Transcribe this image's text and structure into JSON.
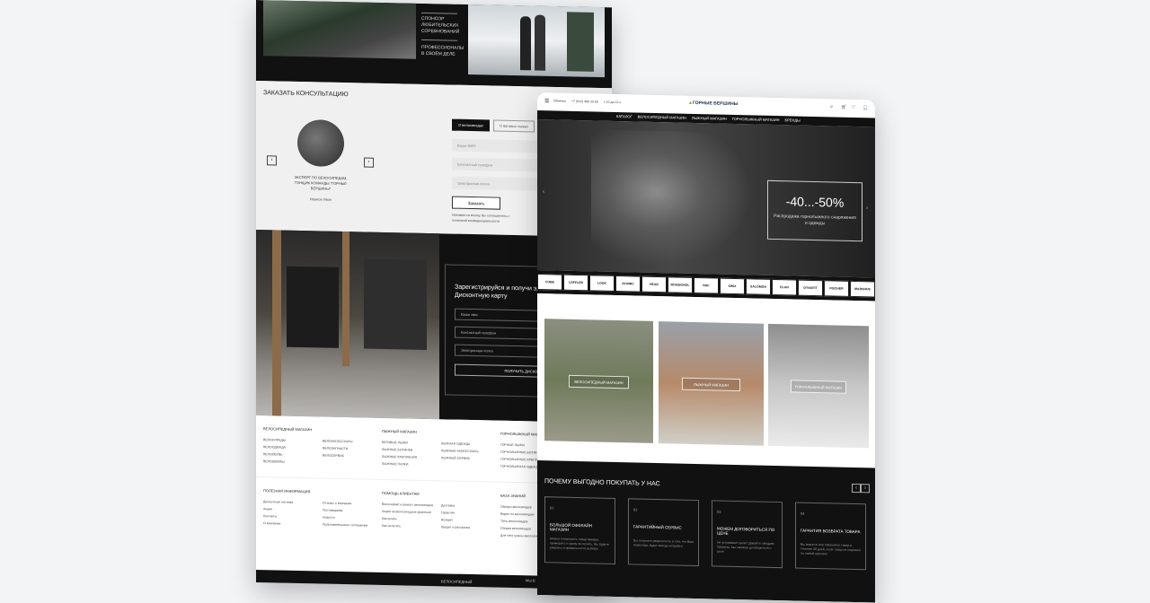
{
  "back": {
    "sponsor_1": "СПОНСОР ЛЮБИТЕЛЬСКИХ СОРЕВНОВАНИЙ",
    "sponsor_2": "ПРОФЕССИОНАЛЫ В СВОЁМ ДЕЛЕ",
    "consult_title": "ЗАКАЗАТЬ КОНСУЛЬТАЦИЮ",
    "expert_caption": "ЭКСПЕРТ ПО ВЕЛОСИПЕДАМ, ГОНЩИК КОМАНДЫ \"ГОРНЫЕ ВЕРШИНЫ\"",
    "expert_name": "Иванов Иван",
    "tab_active": "О велосипедах",
    "tab_inactive": "О беговых лыжах",
    "name_ph": "Ваше ФИО",
    "phone_ph": "Контактный телефон",
    "email_ph": "Электронная почта",
    "order_btn": "Заказать",
    "consent": "Нажимая на кнопку, Вы соглашаетесь с политикой конфиденциальности",
    "register_title": "Зарегистрируйся и получи электронную Дисконтную карту",
    "reg_name_ph": "Ваше имя",
    "reg_phone_ph": "Контактный телефон",
    "reg_email_ph": "Электронная почта",
    "card_btn": "ПОЛУЧИТЬ ДИСКОНТНУЮ КАРТУ",
    "footer_cols": [
      {
        "title": "ВЕЛОСИПЕДНЫЙ МАГАЗИН",
        "items": [
          "ВЕЛОСИПЕДЫ",
          "ВЕЛООДЕЖДА",
          "ВЕЛООБУВЬ",
          "ВЕЛОШЛЕМЫ"
        ]
      },
      {
        "title": "",
        "items": [
          "ВЕЛОАКСЕССУАРЫ",
          "ВЕЛОЗАПЧАСТИ",
          "ВЕЛОСЕРВИС"
        ]
      },
      {
        "title": "ЛЫЖНЫЙ МАГАЗИН",
        "items": [
          "БЕГОВЫЕ ЛЫЖИ",
          "ЛЫЖНЫЕ БОТИНКИ",
          "ЛЫЖНЫЕ КРЕПЛЕНИЯ",
          "ЛЫЖНЫЕ ПАЛКИ"
        ]
      },
      {
        "title": "",
        "items": [
          "ЛЫЖНАЯ ОДЕЖДА",
          "ЛЫЖНЫЕ АКСЕССУАРЫ",
          "ЛЫЖНЫЙ СЕРВИС"
        ]
      },
      {
        "title": "ГОРНОЛЫЖНЫЙ МАГАЗИН",
        "items": [
          "ГОРНЫЕ ЛЫЖИ",
          "ГОРНОЛЫЖНЫЕ БОТИНКИ",
          "ГОРНОЛЫЖНЫЕ КРЕПЛЕНИЯ",
          "ГОРНОЛЫЖНАЯ ОДЕЖДА"
        ]
      }
    ],
    "info_cols": [
      {
        "title": "ПОЛЕЗНАЯ ИНФОРМАЦИЯ",
        "items": [
          "Дисконтная система",
          "Акции",
          "Контакты",
          "О компании"
        ]
      },
      {
        "title": "",
        "items": [
          "Отзывы о компании",
          "Поставщикам",
          "Новости",
          "Пользовательское соглашение"
        ]
      },
      {
        "title": "ПОМОЩЬ КЛИЕНТАМ",
        "items": [
          "Велосервис и ремонт велосипедов",
          "Акция на велосипедное хранение",
          "Как купить",
          "Как оплатить"
        ]
      },
      {
        "title": "",
        "items": [
          "Доставка",
          "Гарантия",
          "Возврат",
          "Кредит и рассрочка"
        ]
      },
      {
        "title": "БАЗА ЗНАНИЙ",
        "items": [
          "Обзоры велосипедов",
          "Видео по велосипедам",
          "Типы велосипедов",
          "Сборка велосипедов",
          "Для чего нужны велосипеды"
        ]
      }
    ],
    "bottom_label": "ВЕЛОСИПЕДНЫЙ",
    "bottom_right": "МЫ В"
  },
  "front": {
    "city": "Обнинск",
    "phone": "+7 (912) 400 33 60",
    "hours": "с 10 до 22 ч",
    "logo": "ГОРНЫЕ ВЕРШИНЫ",
    "nav": [
      "КАТАЛОГ",
      "ВЕЛОСИПЕДНЫЙ МАГАЗИН",
      "ЛЫЖНЫЙ МАГАЗИН",
      "ГОРНОЛЫЖНЫЙ МАГАЗИН",
      "БРЕНДЫ"
    ],
    "hero_discount": "-40...-50%",
    "hero_text": "Распродажа горнолыжного снаряжения и одежды",
    "brands": [
      "CUBE",
      "LÖFFLER",
      "LOOK",
      "ATOMIC",
      "HEAD",
      "ROSSIGNOL",
      "SRC",
      "SWIX",
      "SALOMON",
      "ELAN",
      "DYNAFIT",
      "FISCHER",
      "MADSHUS",
      "SCOTT"
    ],
    "categories": [
      "ВЕЛОСИПЕДНЫЙ МАГАЗИН",
      "ЛЫЖНЫЙ МАГАЗИН",
      "ГОРНОЛЫЖНЫЙ МАГАЗИН"
    ],
    "why_title": "ПОЧЕМУ ВЫГОДНО ПОКУПАТЬ У НАС",
    "why": [
      {
        "n": "01",
        "t": "БОЛЬШОЙ ОФФЛАЙН МАГАЗИН",
        "d": "Можно посмотреть товар вживую, примерить и сразу же купить. Вы будете уверены в правильности выбора"
      },
      {
        "n": "02",
        "t": "ГАРАНТИЙНЫЙ СЕРВИС",
        "d": "Вы получите уверенность в том, что Ваш инвентарь будет всегда исправен"
      },
      {
        "n": "03",
        "t": "МОЖЕМ ДОГОВОРИТЬСЯ ПО ЦЕНЕ",
        "d": "Не устраивает цена? Давайте обсудим. Уверены, мы сможем договориться о цене"
      },
      {
        "n": "04",
        "t": "ГАРАНТИЯ ВОЗВРАТА ТОВАРА",
        "d": "Вы вернете или поменяете товар в течение 30 дней, если товар не подошел по любой причине"
      }
    ]
  }
}
